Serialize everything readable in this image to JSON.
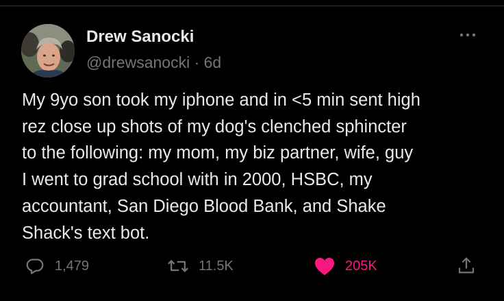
{
  "tweet": {
    "display_name": "Drew Sanocki",
    "handle": "@drewsanocki",
    "separator": "·",
    "age": "6d",
    "text_lines": [
      "My 9yo son took my iphone and in <5 min sent high",
      "rez close up shots of my dog's clenched sphincter",
      "to the following: my mom, my biz partner, wife, guy",
      "I went to grad school with in 2000, HSBC, my",
      "accountant, San Diego Blood Bank, and Shake",
      "Shack's text bot."
    ]
  },
  "actions": {
    "reply": {
      "icon": "reply-bubble-icon",
      "count": "1,479"
    },
    "retweet": {
      "icon": "retweet-icon",
      "count": "11.5K"
    },
    "like": {
      "icon": "heart-filled-icon",
      "count": "205K",
      "active": true
    },
    "share": {
      "icon": "share-icon"
    }
  },
  "colors": {
    "background": "#000000",
    "text": "#e7e9ea",
    "secondary_text": "#71767b",
    "like_active": "#f91880"
  }
}
